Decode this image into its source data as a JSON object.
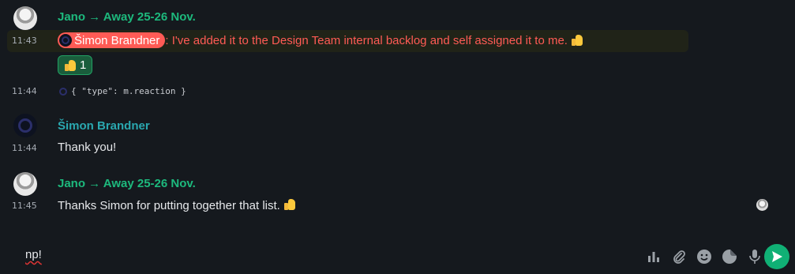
{
  "timeline": {
    "msg1": {
      "sender": "Jano → Away 25-26 Nov.",
      "time": "11:43",
      "mention_name": "Šimon Brandner",
      "text": ": I've added it to the Design Team internal backlog and self assigned it to me.",
      "reaction_count": "1"
    },
    "msg2": {
      "time": "11:44",
      "code": "{ \"type\": m.reaction }"
    },
    "msg3": {
      "sender": "Šimon Brandner",
      "time": "11:44",
      "text": "Thank you!"
    },
    "msg4": {
      "sender": "Jano → Away 25-26 Nov.",
      "time": "11:45",
      "text": "Thanks Simon for putting together that list."
    }
  },
  "composer": {
    "value": "np!",
    "icons": [
      "poll-icon",
      "attachment-icon",
      "emoji-icon",
      "sticker-icon",
      "microphone-icon"
    ],
    "send_icon": "send-icon"
  },
  "colors": {
    "background": "#15191e",
    "sender_green": "#1db97d",
    "sender_teal": "#2aa8b0",
    "mention_red": "#ff5b55",
    "reaction_bg": "#1a5d3c",
    "send_button": "#10b075"
  }
}
